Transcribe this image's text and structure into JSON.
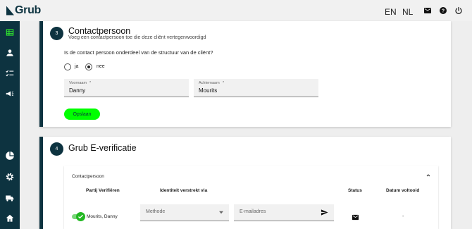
{
  "app": {
    "logo_text": "Grub"
  },
  "header": {
    "lang_en": "EN",
    "lang_nl": "NL",
    "icons": [
      "mail-icon",
      "help-icon",
      "power-icon"
    ]
  },
  "sidebar": {
    "icons": [
      "table-icon",
      "person-icon",
      "checklist-icon",
      "campaign-icon",
      "pie-chart-icon",
      "gear-icon",
      "truck-icon",
      "home-icon"
    ]
  },
  "step3": {
    "number": "3",
    "title": "Contactpersoon",
    "subtitle": "Voeg een contactpersoon toe die deze cliënt vertegenwoordigd",
    "question": "Is de contact persoon onderdeel van de structuur van de cliënt?",
    "options": [
      {
        "label": "ja",
        "selected": false
      },
      {
        "label": "nee",
        "selected": true
      }
    ],
    "first_name": {
      "label": "Voornaam",
      "value": "Danny"
    },
    "last_name": {
      "label": "Achternaam",
      "value": "Mourits"
    },
    "save_label": "Opslaan"
  },
  "step4": {
    "number": "4",
    "title": "Grub E-verificatie",
    "accordion_title": "Contactpersoon",
    "columns": {
      "party": "Partij Verifiëren",
      "identity": "Identiteit verstrekt via",
      "status": "Status",
      "date": "Datum voltooid"
    },
    "row": {
      "name": "Mourits, Danny",
      "verify_enabled": true,
      "method_placeholder": "Methode",
      "email_placeholder": "E-mailadres",
      "status_icon": "mail-icon",
      "date": "-"
    }
  },
  "colors": {
    "primary": "#0d3340",
    "accent": "#00ff00",
    "background": "#eeeeee",
    "toggle_on": "#22b822"
  }
}
